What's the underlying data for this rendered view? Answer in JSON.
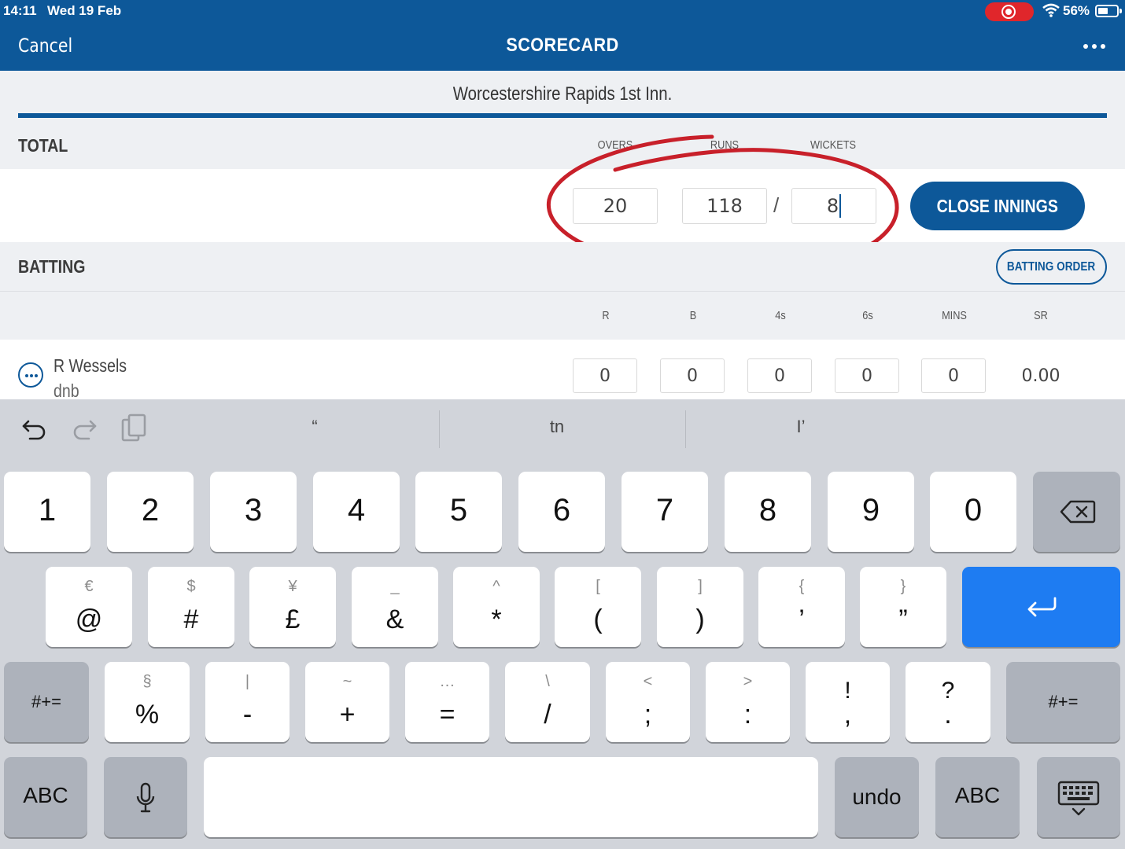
{
  "status_bar": {
    "time": "14:11",
    "date": "Wed 19 Feb",
    "battery_pct": "56%",
    "battery_level": 0.56
  },
  "nav": {
    "cancel": "Cancel",
    "title": "SCORECARD",
    "more_icon": "more-horizontal-icon"
  },
  "innings": {
    "title": "Worcestershire Rapids 1st Inn."
  },
  "total": {
    "label": "TOTAL",
    "headers": {
      "overs": "OVERS",
      "runs": "RUNS",
      "wickets": "WICKETS"
    },
    "overs": "20",
    "runs": "118",
    "separator": "/",
    "wickets": "8",
    "close_button": "CLOSE INNINGS"
  },
  "batting": {
    "label": "BATTING",
    "order_button": "BATTING ORDER",
    "columns": [
      "R",
      "B",
      "4s",
      "6s",
      "MINS",
      "SR"
    ],
    "rows": [
      {
        "name": "R Wessels",
        "status": "dnb",
        "r": "0",
        "b": "0",
        "fours": "0",
        "sixes": "0",
        "mins": "0",
        "sr": "0.00"
      }
    ]
  },
  "keyboard": {
    "suggestions": [
      "“",
      "tn",
      "I’"
    ],
    "row1": [
      "1",
      "2",
      "3",
      "4",
      "5",
      "6",
      "7",
      "8",
      "9",
      "0"
    ],
    "row2": [
      {
        "alt": "€",
        "main": "@"
      },
      {
        "alt": "$",
        "main": "#"
      },
      {
        "alt": "¥",
        "main": "£"
      },
      {
        "alt": "_",
        "main": "&"
      },
      {
        "alt": "^",
        "main": "*"
      },
      {
        "alt": "[",
        "main": "("
      },
      {
        "alt": "]",
        "main": ")"
      },
      {
        "alt": "{",
        "main": "’"
      },
      {
        "alt": "}",
        "main": "”"
      }
    ],
    "row3": [
      {
        "alt": "§",
        "main": "%"
      },
      {
        "alt": "|",
        "main": "-"
      },
      {
        "alt": "~",
        "main": "+"
      },
      {
        "alt": "…",
        "main": "="
      },
      {
        "alt": "\\",
        "main": "/"
      },
      {
        "alt": "<",
        "main": ";"
      },
      {
        "alt": ">",
        "main": ":"
      },
      {
        "alt": "!",
        "main": ","
      },
      {
        "alt": "?",
        "main": "."
      }
    ],
    "shift_label": "#+=",
    "abc_label": "ABC",
    "undo_label": "undo"
  },
  "colors": {
    "nav_blue": "#0d5899",
    "return_blue": "#1e7cf2",
    "annotation_red": "#c8202a"
  }
}
